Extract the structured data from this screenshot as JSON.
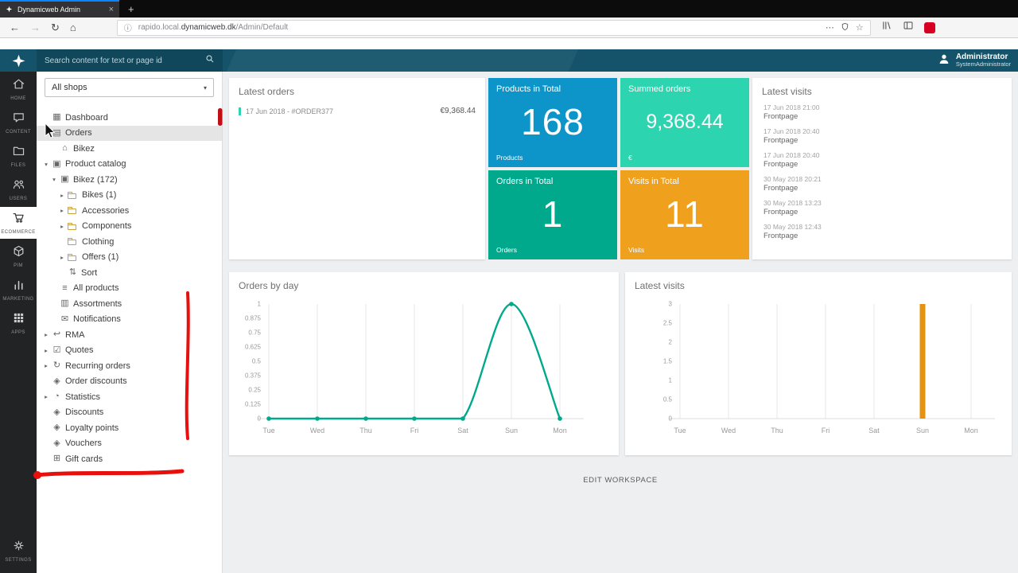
{
  "browser": {
    "tab_title": "Dynamicweb Admin",
    "url_prefix": "rapido.local.",
    "url_domain": "dynamicweb.dk",
    "url_path": "/Admin/Default"
  },
  "header": {
    "search_placeholder": "Search content for text or page id",
    "user_name": "Administrator",
    "user_role": "SystemAdministrator"
  },
  "rail": {
    "items": [
      {
        "label": "HOME",
        "icon": "home",
        "selected": false
      },
      {
        "label": "CONTENT",
        "icon": "content",
        "selected": false
      },
      {
        "label": "FILES",
        "icon": "files",
        "selected": false
      },
      {
        "label": "USERS",
        "icon": "users",
        "selected": false
      },
      {
        "label": "ECOMMERCE",
        "icon": "ecommerce",
        "selected": true
      },
      {
        "label": "PIM",
        "icon": "pim",
        "selected": false
      },
      {
        "label": "MARKETING",
        "icon": "marketing",
        "selected": false
      },
      {
        "label": "APPS",
        "icon": "apps",
        "selected": false
      }
    ],
    "bottom_item": {
      "label": "SETTINGS",
      "icon": "settings",
      "selected": false
    }
  },
  "sidebar": {
    "shop_selector": "All shops",
    "tree": [
      {
        "label": "Dashboard",
        "icon": "dashboard",
        "level": 0,
        "arrow": "none",
        "selected": false
      },
      {
        "label": "Orders",
        "icon": "orders",
        "level": 0,
        "arrow": "down",
        "selected": true
      },
      {
        "label": "Bikez",
        "icon": "shop",
        "level": 1,
        "arrow": "none",
        "selected": false
      },
      {
        "label": "Product catalog",
        "icon": "catalog",
        "level": 0,
        "arrow": "down",
        "selected": false
      },
      {
        "label": "Bikez (172)",
        "icon": "catalog",
        "level": 1,
        "arrow": "down",
        "selected": false
      },
      {
        "label": "Bikes (1)",
        "icon": "folder",
        "level": 2,
        "arrow": "right",
        "selected": false
      },
      {
        "label": "Accessories",
        "icon": "folder",
        "level": 2,
        "arrow": "right",
        "selected": false
      },
      {
        "label": "Components",
        "icon": "folder",
        "level": 2,
        "arrow": "right",
        "selected": false
      },
      {
        "label": "Clothing",
        "icon": "folder",
        "level": 2,
        "arrow": "none",
        "selected": false
      },
      {
        "label": "Offers (1)",
        "icon": "folder",
        "level": 2,
        "arrow": "right",
        "selected": false
      },
      {
        "label": "Sort",
        "icon": "sort",
        "level": 2,
        "arrow": "none",
        "selected": false
      },
      {
        "label": "All products",
        "icon": "list",
        "level": 1,
        "arrow": "none",
        "selected": false
      },
      {
        "label": "Assortments",
        "icon": "assortments",
        "level": 1,
        "arrow": "none",
        "selected": false
      },
      {
        "label": "Notifications",
        "icon": "envelope",
        "level": 1,
        "arrow": "none",
        "selected": false
      },
      {
        "label": "RMA",
        "icon": "rma",
        "level": 0,
        "arrow": "right",
        "selected": false
      },
      {
        "label": "Quotes",
        "icon": "quotes",
        "level": 0,
        "arrow": "right",
        "selected": false
      },
      {
        "label": "Recurring orders",
        "icon": "recurring",
        "level": 0,
        "arrow": "right",
        "selected": false
      },
      {
        "label": "Order discounts",
        "icon": "tag",
        "level": 0,
        "arrow": "none",
        "selected": false
      },
      {
        "label": "Statistics",
        "icon": "statistics",
        "level": 0,
        "arrow": "right",
        "selected": false
      },
      {
        "label": "Discounts",
        "icon": "tag",
        "level": 0,
        "arrow": "none",
        "selected": false
      },
      {
        "label": "Loyalty points",
        "icon": "tag",
        "level": 0,
        "arrow": "none",
        "selected": false
      },
      {
        "label": "Vouchers",
        "icon": "tag",
        "level": 0,
        "arrow": "none",
        "selected": false
      },
      {
        "label": "Gift cards",
        "icon": "gift",
        "level": 0,
        "arrow": "none",
        "selected": false
      }
    ]
  },
  "main": {
    "latest_orders": {
      "title": "Latest orders",
      "rows": [
        {
          "date": "17 Jun 2018 - #ORDER377",
          "amount": "€9,368.44"
        }
      ]
    },
    "tiles": [
      {
        "title": "Products in Total",
        "value": "168",
        "label": "Products",
        "color": "#0d94c8"
      },
      {
        "title": "Summed orders",
        "value": "9,368.44",
        "label": "€",
        "color": "#2dd4b0"
      },
      {
        "title": "Orders in Total",
        "value": "1",
        "label": "Orders",
        "color": "#00a98c"
      },
      {
        "title": "Visits in Total",
        "value": "11",
        "label": "Visits",
        "color": "#efa11d"
      }
    ],
    "latest_visits_list": {
      "title": "Latest visits",
      "entries": [
        {
          "date": "17 Jun 2018 21:00",
          "page": "Frontpage"
        },
        {
          "date": "17 Jun 2018 20:40",
          "page": "Frontpage"
        },
        {
          "date": "17 Jun 2018 20:40",
          "page": "Frontpage"
        },
        {
          "date": "30 May 2018 20:21",
          "page": "Frontpage"
        },
        {
          "date": "30 May 2018 13:23",
          "page": "Frontpage"
        },
        {
          "date": "30 May 2018 12:43",
          "page": "Frontpage"
        }
      ]
    },
    "edit_workspace": "EDIT WORKSPACE"
  },
  "chart_data": [
    {
      "type": "line",
      "title": "Orders by day",
      "categories": [
        "Tue",
        "Wed",
        "Thu",
        "Fri",
        "Sat",
        "Sun",
        "Mon"
      ],
      "values": [
        0,
        0,
        0,
        0,
        0,
        1,
        0
      ],
      "ylim": [
        0,
        1
      ],
      "yticks": [
        "0",
        "0.125",
        "0.25",
        "0.375",
        "0.5",
        "0.625",
        "0.75",
        "0.875",
        "1"
      ],
      "color": "#00a98c",
      "grid": "vertical",
      "legend": "none"
    },
    {
      "type": "bar",
      "title": "Latest visits",
      "categories": [
        "Tue",
        "Wed",
        "Thu",
        "Fri",
        "Sat",
        "Sun",
        "Mon"
      ],
      "values": [
        0,
        0,
        0,
        0,
        0,
        3,
        0
      ],
      "ylim": [
        0,
        3
      ],
      "yticks": [
        "0",
        "0.5",
        "1",
        "1.5",
        "2",
        "2.5",
        "3"
      ],
      "color": "#e5920f",
      "grid": "vertical",
      "legend": "none"
    }
  ],
  "annotations": {
    "marker_color": "#e8100c",
    "accent_bar_color": "#c01015"
  }
}
